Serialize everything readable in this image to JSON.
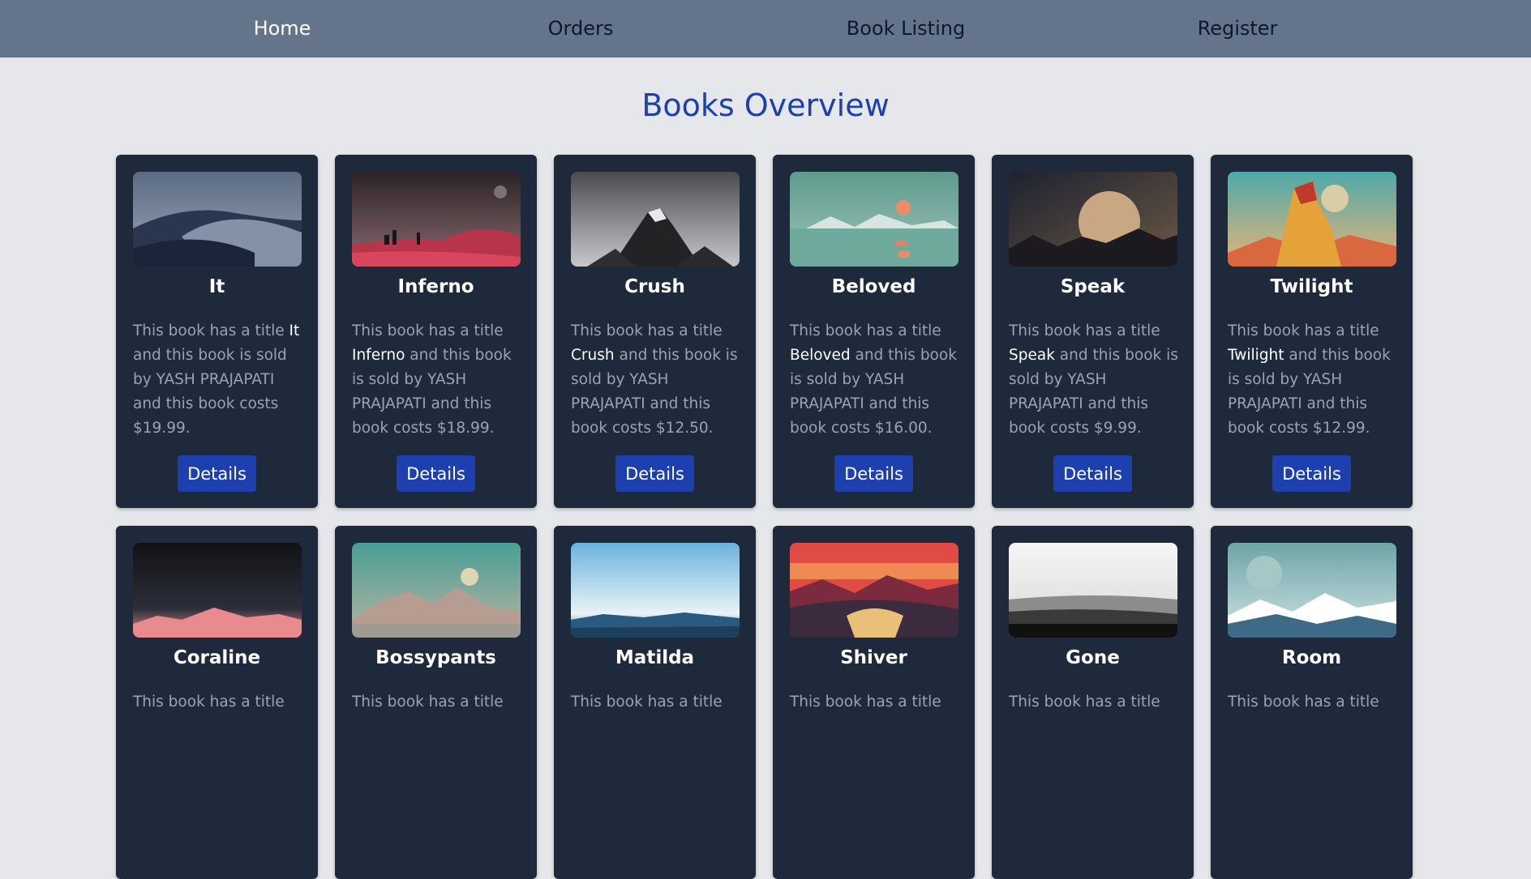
{
  "nav": {
    "items": [
      {
        "label": "Home",
        "active": true
      },
      {
        "label": "Orders",
        "active": false
      },
      {
        "label": "Book Listing",
        "active": false
      },
      {
        "label": "Register",
        "active": false
      }
    ]
  },
  "page": {
    "title": "Books Overview"
  },
  "desc_template": {
    "prefix": "This book has a title ",
    "middle": " and this book is sold by ",
    "seller_suffix": " and this book costs ",
    "end": "."
  },
  "books": [
    {
      "title": "It",
      "seller": "YASH PRAJAPATI",
      "price": "$19.99",
      "button": "Details",
      "cover": "desert-dunes"
    },
    {
      "title": "Inferno",
      "seller": "YASH PRAJAPATI",
      "price": "$18.99",
      "button": "Details",
      "cover": "red-planet"
    },
    {
      "title": "Crush",
      "seller": "YASH PRAJAPATI",
      "price": "$12.50",
      "button": "Details",
      "cover": "grey-mountain"
    },
    {
      "title": "Beloved",
      "seller": "YASH PRAJAPATI",
      "price": "$16.00",
      "button": "Details",
      "cover": "teal-sunset-lake"
    },
    {
      "title": "Speak",
      "seller": "YASH PRAJAPATI",
      "price": "$9.99",
      "button": "Details",
      "cover": "planet-rising"
    },
    {
      "title": "Twilight",
      "seller": "YASH PRAJAPATI",
      "price": "$12.99",
      "button": "Details",
      "cover": "orange-rock-tower"
    },
    {
      "title": "Coraline",
      "seller": "",
      "price": "",
      "button": "",
      "cover": "pink-peaks-night"
    },
    {
      "title": "Bossypants",
      "seller": "",
      "price": "",
      "button": "",
      "cover": "teal-mountains"
    },
    {
      "title": "Matilda",
      "seller": "",
      "price": "",
      "button": "",
      "cover": "blue-sky-horizon"
    },
    {
      "title": "Shiver",
      "seller": "",
      "price": "",
      "button": "",
      "cover": "red-valley"
    },
    {
      "title": "Gone",
      "seller": "",
      "price": "",
      "button": "",
      "cover": "monochrome-hills"
    },
    {
      "title": "Room",
      "seller": "",
      "price": "",
      "button": "",
      "cover": "icy-moon"
    }
  ],
  "colors": {
    "navbar": "#64748b",
    "background": "#e5e7eb",
    "card": "#1e293b",
    "accent": "#1e40af"
  }
}
